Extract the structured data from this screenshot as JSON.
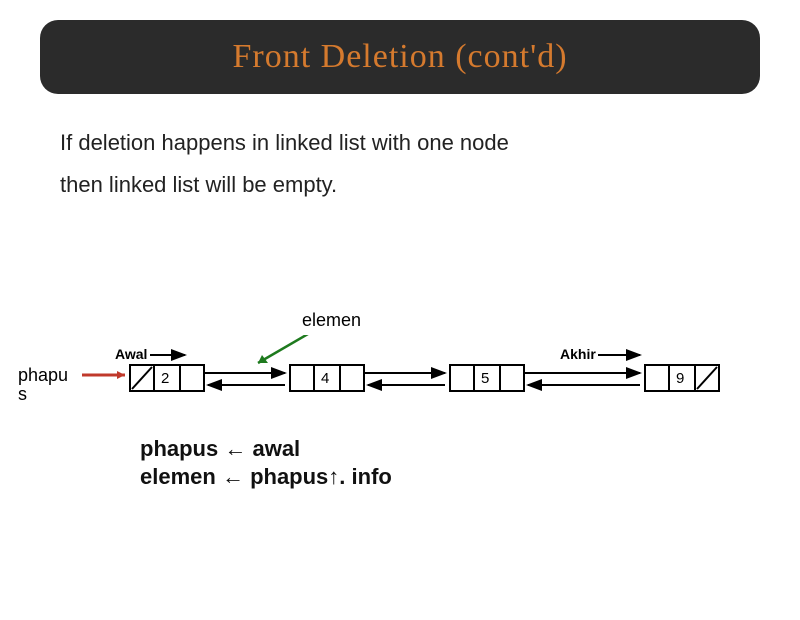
{
  "title": "Front Deletion (cont'd)",
  "body_line1": "If deletion happens in linked list with one node",
  "body_line2": "then linked list will be empty.",
  "labels": {
    "elemen": "elemen",
    "phapus": "phapu s",
    "awal": "Awal",
    "akhir": "Akhir"
  },
  "nodes": [
    "2",
    "4",
    "5",
    "9"
  ],
  "assign": {
    "line1_left": "phapus",
    "arrow": " ← ",
    "line1_right": "awal",
    "line2_left": "elemen",
    "line2_right": "phapus↑. info"
  }
}
